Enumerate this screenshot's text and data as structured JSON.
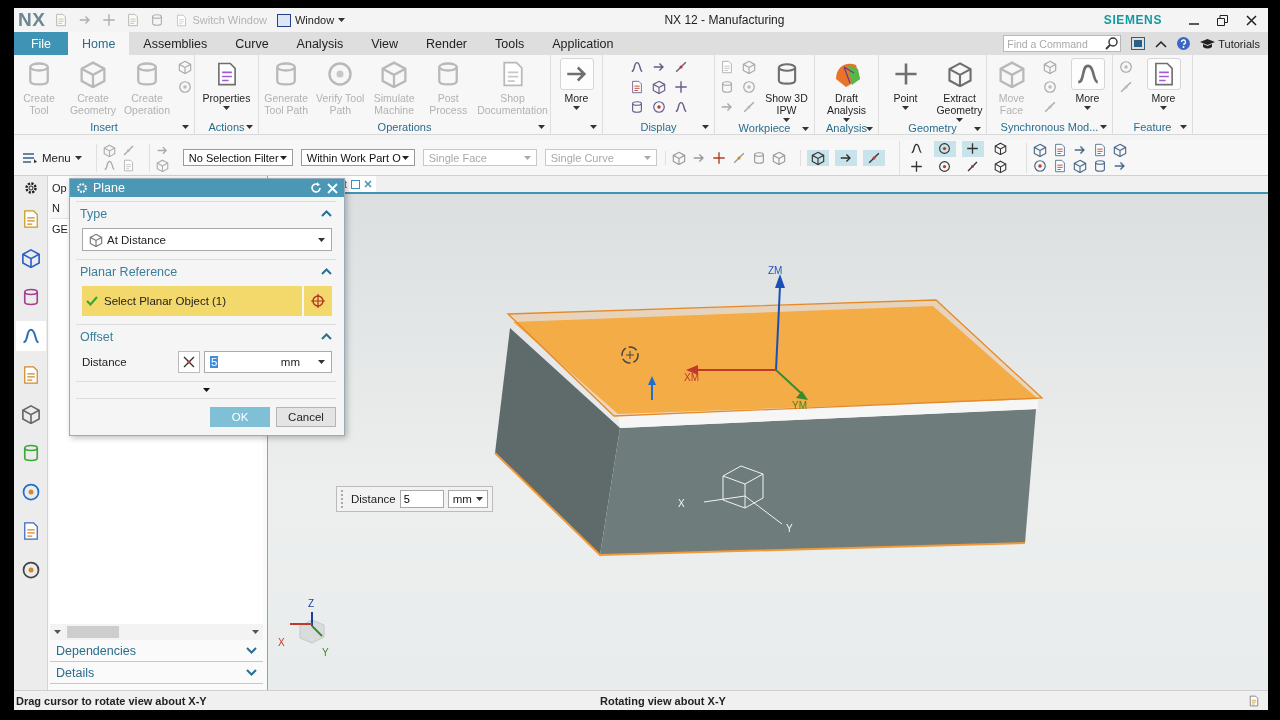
{
  "title_bar": {
    "logo": "NX",
    "switch_window": {
      "label": "Switch Window",
      "disabled": true
    },
    "window_menu": "Window",
    "title": "NX 12 - Manufacturing",
    "brand": "SIEMENS"
  },
  "tabs": [
    {
      "label": "File",
      "kind": "file",
      "selected": false
    },
    {
      "label": "Home",
      "kind": "tab",
      "selected": true
    },
    {
      "label": "Assemblies",
      "kind": "tab",
      "selected": false
    },
    {
      "label": "Curve",
      "kind": "tab",
      "selected": false
    },
    {
      "label": "Analysis",
      "kind": "tab",
      "selected": false
    },
    {
      "label": "View",
      "kind": "tab",
      "selected": false
    },
    {
      "label": "Render",
      "kind": "tab",
      "selected": false
    },
    {
      "label": "Tools",
      "kind": "tab",
      "selected": false
    },
    {
      "label": "Application",
      "kind": "tab",
      "selected": false
    }
  ],
  "search": {
    "placeholder": "Find a Command"
  },
  "help_link": "Tutorials",
  "ribbon": {
    "groups": [
      {
        "label": "Insert",
        "items": [
          {
            "label": "Create Tool",
            "disabled": true,
            "menu": false
          },
          {
            "label": "Create Geometry",
            "disabled": true,
            "menu": false
          },
          {
            "label": "Create Operation",
            "disabled": true,
            "menu": false
          }
        ]
      },
      {
        "label": "Actions",
        "items": [
          {
            "label": "Properties",
            "disabled": false,
            "menu": true
          }
        ]
      },
      {
        "label": "Operations",
        "items": [
          {
            "label": "Generate Tool Path",
            "disabled": true,
            "menu": false
          },
          {
            "label": "Verify Tool Path",
            "disabled": true,
            "menu": false
          },
          {
            "label": "Simulate Machine",
            "disabled": true,
            "menu": false
          },
          {
            "label": "Post Process",
            "disabled": true,
            "menu": false
          },
          {
            "label": "Shop Documentation",
            "disabled": true,
            "menu": false
          }
        ]
      },
      {
        "items": [
          {
            "label": "More",
            "disabled": false,
            "menu": true
          }
        ]
      },
      {
        "label": "Display"
      },
      {
        "label": "Workpiece",
        "items": [
          {
            "label": "Show 3D IPW",
            "disabled": false,
            "menu": true
          }
        ]
      },
      {
        "label": "Analysis",
        "items": [
          {
            "label": "Draft Analysis",
            "disabled": false,
            "menu": true
          }
        ]
      },
      {
        "label": "Geometry",
        "items": [
          {
            "label": "Point",
            "disabled": false,
            "menu": true
          },
          {
            "label": "Extract Geometry",
            "disabled": false,
            "menu": true
          }
        ]
      },
      {
        "label": "Synchronous Mod...",
        "items": [
          {
            "label": "Move Face",
            "disabled": true,
            "menu": false
          },
          {
            "label": "More",
            "disabled": false,
            "menu": true
          }
        ]
      },
      {
        "label": "Feature",
        "items": [
          {
            "label": "More",
            "disabled": false,
            "menu": true
          }
        ]
      }
    ]
  },
  "toolbar": {
    "menu": "Menu",
    "filters": [
      {
        "value": "No Selection Filter",
        "disabled": false
      },
      {
        "value": "Within Work Part O",
        "disabled": false
      },
      {
        "value": "Single Face",
        "disabled": true
      },
      {
        "value": "Single Curve",
        "disabled": true
      }
    ],
    "snap_toggles": [
      {
        "on": true
      },
      {
        "on": true
      },
      {
        "on": true
      },
      {
        "on": false
      },
      {
        "on": true
      },
      {
        "on": true
      },
      {
        "on": false
      },
      {
        "on": false
      },
      {
        "on": false
      },
      {
        "on": false
      },
      {
        "on": false
      }
    ]
  },
  "resource_bar": [
    {
      "selected": false
    },
    {
      "selected": false
    },
    {
      "selected": false
    },
    {
      "selected": true
    },
    {
      "selected": false
    },
    {
      "selected": false
    },
    {
      "selected": false
    },
    {
      "selected": false
    },
    {
      "selected": false
    },
    {
      "selected": false
    }
  ],
  "navigator": {
    "title": "Op",
    "column": "N",
    "row": "GE",
    "panels": [
      {
        "title": "Dependencies",
        "expanded": false
      },
      {
        "title": "Details",
        "expanded": false
      }
    ]
  },
  "view_tab": {
    "label": "t"
  },
  "dialog": {
    "title": "Plane",
    "sections": [
      {
        "title": "Type",
        "expanded": true,
        "kind": "dropdown",
        "value": "At Distance"
      },
      {
        "title": "Planar Reference",
        "expanded": true,
        "kind": "selection",
        "value": "Select Planar Object (1)",
        "selected": true
      },
      {
        "title": "Offset",
        "expanded": true,
        "kind": "expression",
        "label": "Distance",
        "value": "5",
        "unit": "mm"
      }
    ],
    "buttons": [
      {
        "label": "OK",
        "kind": "primary"
      },
      {
        "label": "Cancel",
        "kind": "secondary"
      }
    ]
  },
  "floating_input": {
    "label": "Distance",
    "value": "5",
    "unit": "mm"
  },
  "view_labels": {
    "wcs": [
      "ZM",
      "XM",
      "YM"
    ],
    "csys": [
      "X",
      "Y"
    ],
    "triad": [
      "Z",
      "X",
      "Y"
    ]
  },
  "status_bar": {
    "prompt": "Drag cursor to rotate view about X-Y",
    "status": "Rotating view about X-Y"
  }
}
